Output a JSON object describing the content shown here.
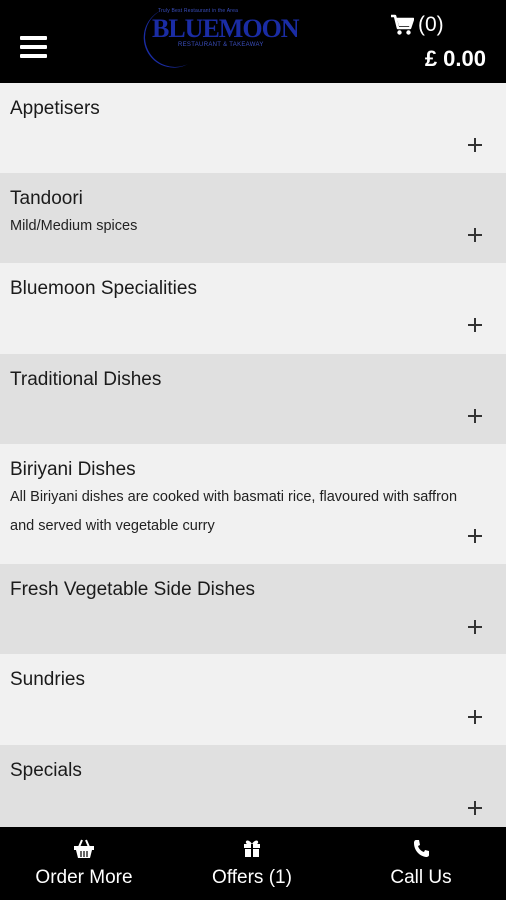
{
  "header": {
    "logo": {
      "tagline": "Truly Best Restaurant in the Area",
      "word": "BLUEMOON",
      "subtitle": "RESTAURANT & TAKEAWAY"
    },
    "cart": {
      "count": "(0)",
      "total": "£ 0.00"
    }
  },
  "menu": {
    "categories": [
      {
        "title": "Appetisers",
        "description": ""
      },
      {
        "title": "Tandoori",
        "description": "Mild/Medium spices"
      },
      {
        "title": "Bluemoon Specialities",
        "description": ""
      },
      {
        "title": "Traditional Dishes",
        "description": ""
      },
      {
        "title": "Biriyani Dishes",
        "description": "All Biriyani dishes are cooked with basmati rice, flavoured with saffron and served with vegetable curry"
      },
      {
        "title": "Fresh Vegetable Side Dishes",
        "description": ""
      },
      {
        "title": "Sundries",
        "description": ""
      },
      {
        "title": "Specials",
        "description": ""
      }
    ]
  },
  "bottom_nav": {
    "order_more": "Order More",
    "offers": "Offers (1)",
    "call_us": "Call Us"
  },
  "colors": {
    "header_bg": "#000000",
    "logo_blue": "#1a2ca4",
    "row_light": "#f1f1f1",
    "row_dark": "#e0e0e0"
  },
  "icons": [
    "menu-icon",
    "cart-icon",
    "plus-icon",
    "basket-icon",
    "gift-icon",
    "phone-icon"
  ]
}
